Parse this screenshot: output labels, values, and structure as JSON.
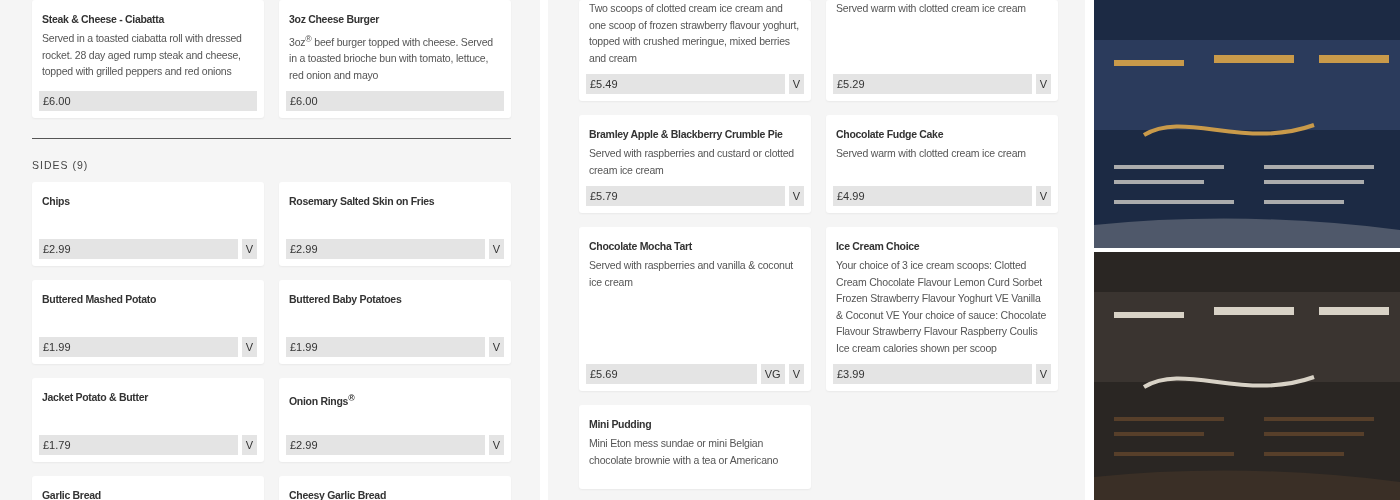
{
  "left": {
    "items": [
      {
        "name": "Steak & Cheese - Ciabatta",
        "description": "Served in a toasted ciabatta roll with dressed rocket. 28 day aged rump steak and cheese, topped with grilled peppers and red onions",
        "price": "£6.00"
      },
      {
        "name": "3oz Cheese Burger",
        "description": "3oz$^{®}$ beef burger topped with cheese. Served in a toasted brioche bun with tomato, lettuce, red onion and mayo",
        "price": "£6.00"
      }
    ],
    "sections": [
      {
        "title": "SIDES (9)",
        "items": [
          {
            "name": "Chips",
            "price": "£2.99",
            "tags": [
              "V"
            ]
          },
          {
            "name": "Rosemary Salted Skin on Fries",
            "price": "£2.99",
            "tags": [
              "V"
            ]
          },
          {
            "name": "Buttered Mashed Potato",
            "price": "£1.99",
            "tags": [
              "V"
            ]
          },
          {
            "name": "Buttered Baby Potatoes",
            "price": "£1.99",
            "tags": [
              "V"
            ]
          },
          {
            "name": "Jacket Potato & Butter",
            "price": "£1.79",
            "tags": [
              "V"
            ]
          },
          {
            "name": "Onion Rings$^{®}$",
            "price": "£2.99",
            "tags": [
              "V"
            ]
          },
          {
            "name": "Garlic Bread"
          },
          {
            "name": "Cheesy Garlic Bread"
          }
        ]
      }
    ]
  },
  "middle": {
    "items": [
      {
        "description": "Two scoops of clotted cream ice cream and one scoop of frozen strawberry flavour yoghurt, topped with crushed meringue, mixed berries and cream",
        "price": "£5.49",
        "tags": [
          "V"
        ]
      },
      {
        "description": "Served warm with clotted cream ice cream",
        "price": "£5.29",
        "tags": [
          "V"
        ]
      },
      {
        "name": "Bramley Apple & Blackberry Crumble Pie",
        "description": "Served with raspberries and custard or clotted cream ice cream",
        "price": "£5.79",
        "tags": [
          "V"
        ]
      },
      {
        "name": "Chocolate Fudge Cake",
        "description": "Served warm with clotted cream ice cream",
        "price": "£4.99",
        "tags": [
          "V"
        ]
      },
      {
        "name": "Chocolate Mocha Tart",
        "description": "Served with raspberries and vanilla & coconut ice cream",
        "price": "£5.69",
        "tags": [
          "VG",
          "V"
        ]
      },
      {
        "name": "Ice Cream Choice",
        "description": "Your choice of 3 ice cream scoops: Clotted Cream Chocolate Flavour Lemon Curd Sorbet Frozen Strawberry Flavour Yoghurt VE Vanilla & Coconut VE Your choice of sauce: Chocolate Flavour Strawberry Flavour Raspberry Coulis Ice cream calories shown per scoop",
        "price": "£3.99",
        "tags": [
          "V"
        ]
      },
      {
        "name": "Mini Pudding",
        "description": "Mini Eton mess sundae or mini Belgian chocolate brownie with a tea or Americano"
      }
    ]
  }
}
